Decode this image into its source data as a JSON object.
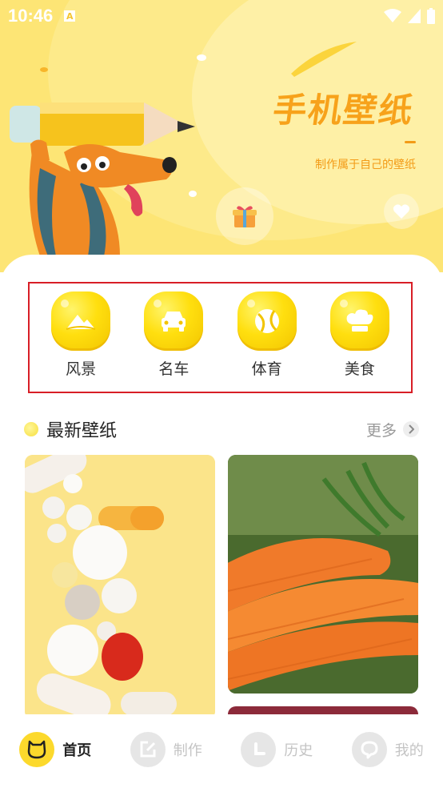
{
  "status_bar": {
    "time": "10:46",
    "indicator": "A"
  },
  "banner": {
    "title": "手机壁纸",
    "subtitle": "制作属于自己的壁纸",
    "gift_icon": "gift-icon",
    "heart_icon": "heart-icon"
  },
  "categories": [
    {
      "label": "风景",
      "icon": "mountain-icon"
    },
    {
      "label": "名车",
      "icon": "car-icon"
    },
    {
      "label": "体育",
      "icon": "ball-icon"
    },
    {
      "label": "美食",
      "icon": "chef-hat-icon"
    }
  ],
  "latest": {
    "title": "最新壁纸",
    "more_label": "更多"
  },
  "bottom_nav": [
    {
      "label": "首页",
      "icon": "bear-face-icon",
      "active": true
    },
    {
      "label": "制作",
      "icon": "edit-icon",
      "active": false
    },
    {
      "label": "历史",
      "icon": "clock-icon",
      "active": false
    },
    {
      "label": "我的",
      "icon": "user-icon",
      "active": false
    }
  ],
  "colors": {
    "accent": "#fcd92c",
    "header_bg": "#fde575",
    "title": "#f7a21b",
    "highlight_box": "#d81e26"
  }
}
